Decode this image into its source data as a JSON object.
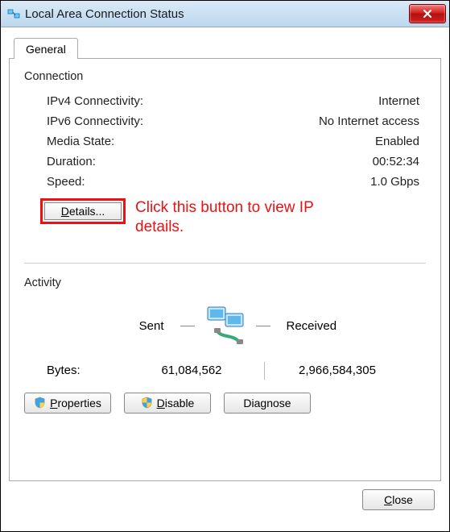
{
  "window": {
    "title": "Local Area Connection Status"
  },
  "tab": {
    "label": "General"
  },
  "connection": {
    "group_label": "Connection",
    "rows": {
      "ipv4_label": "IPv4 Connectivity:",
      "ipv4_value": "Internet",
      "ipv6_label": "IPv6 Connectivity:",
      "ipv6_value": "No Internet access",
      "media_label": "Media State:",
      "media_value": "Enabled",
      "duration_label": "Duration:",
      "duration_value": "00:52:34",
      "speed_label": "Speed:",
      "speed_value": "1.0 Gbps"
    },
    "details_button": "Details...",
    "annotation": "Click this button to view IP details."
  },
  "activity": {
    "group_label": "Activity",
    "sent_label": "Sent",
    "received_label": "Received",
    "bytes_label": "Bytes:",
    "bytes_sent": "61,084,562",
    "bytes_received": "2,966,584,305"
  },
  "buttons": {
    "properties": "Properties",
    "disable": "Disable",
    "diagnose": "Diagnose",
    "close": "Close"
  }
}
